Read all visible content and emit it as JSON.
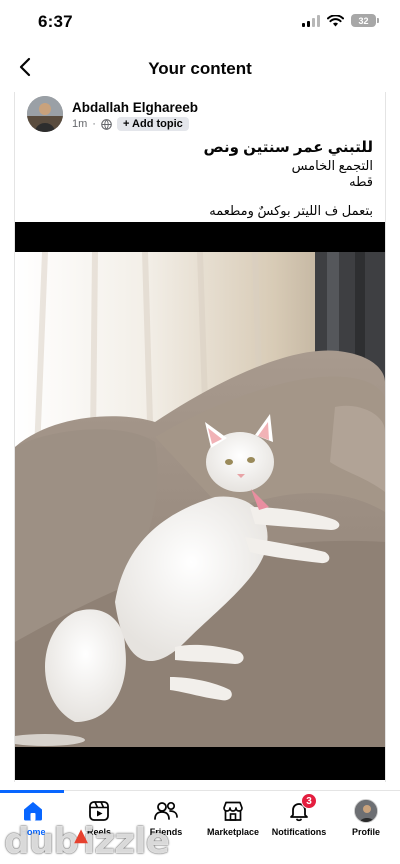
{
  "status_bar": {
    "time": "6:37",
    "battery": "32"
  },
  "header": {
    "title": "Your content"
  },
  "post": {
    "author": "Abdallah Elghareeb",
    "time": "1m",
    "add_topic": "+ Add topic",
    "text": {
      "line1": "للتبني عمر سنتين ونص",
      "line2": "التجمع الخامس",
      "line3": "قطه",
      "line4": "بتعمل ف الليتر بوكسٌ ومطعمه"
    }
  },
  "tab_bar": {
    "tabs": [
      {
        "label": "Home",
        "icon": "home-icon"
      },
      {
        "label": "Reels",
        "icon": "reels-icon"
      },
      {
        "label": "Friends",
        "icon": "friends-icon"
      },
      {
        "label": "Marketplace",
        "icon": "marketplace-icon"
      },
      {
        "label": "Notifications",
        "icon": "bell-icon",
        "badge": "3"
      },
      {
        "label": "Profile",
        "icon": "profile-avatar"
      }
    ],
    "active_color": "#0866ff"
  },
  "watermark": {
    "text": "dubizzle"
  }
}
